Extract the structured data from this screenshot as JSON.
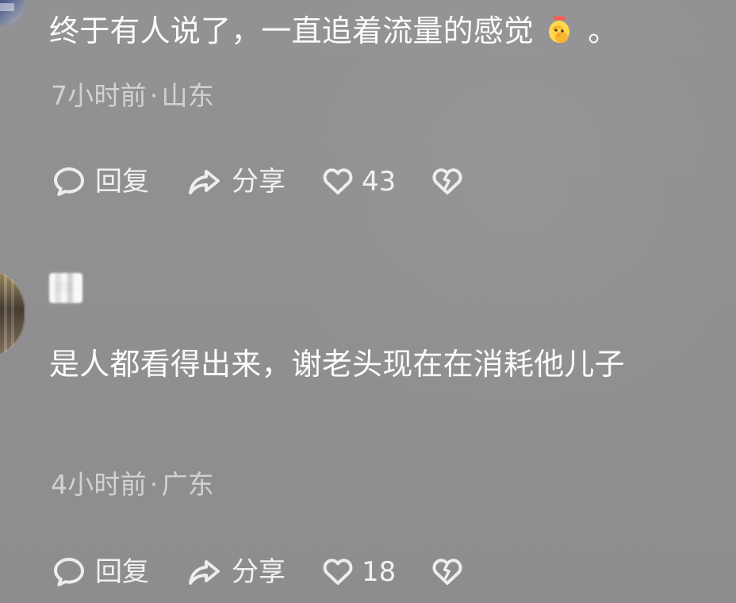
{
  "comments": [
    {
      "text_before_emoji": "终于有人说了，一直追着流量的感觉",
      "emoji_name": "chick-icon",
      "text_after_emoji": "。",
      "meta": {
        "time": "7小时前",
        "dot": "·",
        "location": "山东"
      },
      "actions": {
        "reply": "回复",
        "share": "分享",
        "likes": "43"
      }
    },
    {
      "text": "是人都看得出来，谢老头现在在消耗他儿子",
      "meta": {
        "time": "4小时前",
        "dot": "·",
        "location": "广东"
      },
      "actions": {
        "reply": "回复",
        "share": "分享",
        "likes": "18"
      }
    }
  ],
  "colors": {
    "background": "#8f8f91",
    "primary_text": "#fbfbfb",
    "meta_text": "#d2d2d4",
    "icon": "#ededee"
  }
}
